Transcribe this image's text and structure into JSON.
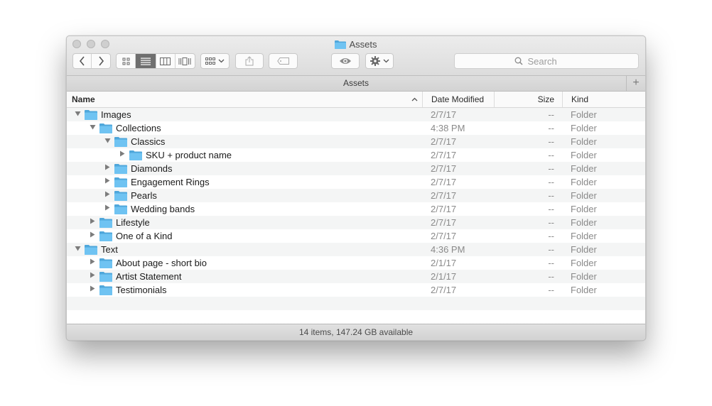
{
  "window": {
    "title": "Assets",
    "path_tab": "Assets",
    "plus_label": "+",
    "status": "14 items, 147.24 GB available"
  },
  "toolbar": {
    "search_placeholder": "Search"
  },
  "columns": {
    "name": "Name",
    "date": "Date Modified",
    "size": "Size",
    "kind": "Kind"
  },
  "colors": {
    "folder": "#6fc3f2",
    "folder_tab": "#4fa7db"
  },
  "rows": [
    {
      "name": "Images",
      "date": "2/7/17",
      "size": "--",
      "kind": "Folder",
      "level": 0,
      "expanded": true
    },
    {
      "name": "Collections",
      "date": "4:38 PM",
      "size": "--",
      "kind": "Folder",
      "level": 1,
      "expanded": true
    },
    {
      "name": "Classics",
      "date": "2/7/17",
      "size": "--",
      "kind": "Folder",
      "level": 2,
      "expanded": true
    },
    {
      "name": "SKU + product name",
      "date": "2/7/17",
      "size": "--",
      "kind": "Folder",
      "level": 3,
      "expanded": false
    },
    {
      "name": "Diamonds",
      "date": "2/7/17",
      "size": "--",
      "kind": "Folder",
      "level": 2,
      "expanded": false
    },
    {
      "name": "Engagement Rings",
      "date": "2/7/17",
      "size": "--",
      "kind": "Folder",
      "level": 2,
      "expanded": false
    },
    {
      "name": "Pearls",
      "date": "2/7/17",
      "size": "--",
      "kind": "Folder",
      "level": 2,
      "expanded": false
    },
    {
      "name": "Wedding bands",
      "date": "2/7/17",
      "size": "--",
      "kind": "Folder",
      "level": 2,
      "expanded": false
    },
    {
      "name": "Lifestyle",
      "date": "2/7/17",
      "size": "--",
      "kind": "Folder",
      "level": 1,
      "expanded": false
    },
    {
      "name": "One of a Kind",
      "date": "2/7/17",
      "size": "--",
      "kind": "Folder",
      "level": 1,
      "expanded": false
    },
    {
      "name": "Text",
      "date": "4:36 PM",
      "size": "--",
      "kind": "Folder",
      "level": 0,
      "expanded": true
    },
    {
      "name": "About page - short bio",
      "date": "2/1/17",
      "size": "--",
      "kind": "Folder",
      "level": 1,
      "expanded": false
    },
    {
      "name": "Artist Statement",
      "date": "2/1/17",
      "size": "--",
      "kind": "Folder",
      "level": 1,
      "expanded": false
    },
    {
      "name": "Testimonials",
      "date": "2/7/17",
      "size": "--",
      "kind": "Folder",
      "level": 1,
      "expanded": false
    }
  ]
}
